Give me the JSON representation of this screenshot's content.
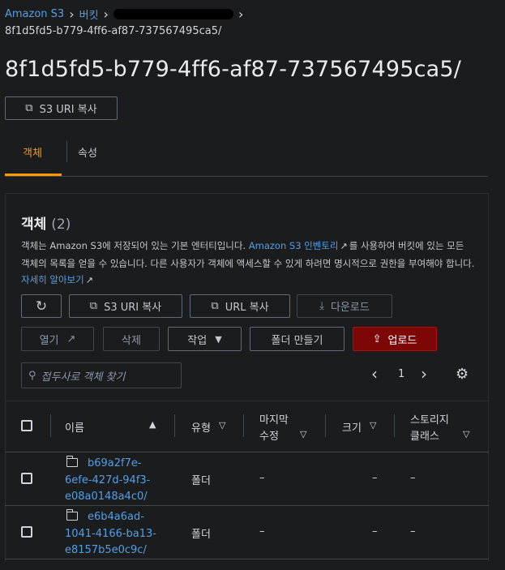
{
  "breadcrumb": {
    "items": [
      "Amazon S3",
      "버킷"
    ],
    "current": "8f1d5fd5-b779-4ff6-af87-737567495ca5/"
  },
  "page": {
    "title": "8f1d5fd5-b779-4ff6-af87-737567495ca5/",
    "copy_s3_uri": "S3 URI 복사"
  },
  "tabs": [
    {
      "label": "객체",
      "active": true
    },
    {
      "label": "속성",
      "active": false
    }
  ],
  "objects_panel": {
    "title": "객체",
    "count": "(2)",
    "description": {
      "part1": "객체는 Amazon S3에 저장되어 있는 기본 엔터티입니다.",
      "link1": "Amazon S3 인벤토리",
      "part2": "를 사용하여 버킷에 있는 모든 객체의 목록을 얻을 수 있습니다. 다른 사용자가 객체에 액세스할 수 있게 하려면 명시적으로 권한을 부여해야 합니다.",
      "link2": "자세히 알아보기"
    },
    "actions": {
      "refresh": "",
      "copy_s3_uri": "S3 URI 복사",
      "copy_url": "URL 복사",
      "download": "다운로드",
      "open": "열기",
      "delete": "삭제",
      "actions": "작업",
      "create_folder": "폴더 만들기",
      "upload": "업로드"
    },
    "search_placeholder": "접두사로 객체 찾기",
    "page_number": "1",
    "columns": [
      "이름",
      "유형",
      "마지막 수정",
      "크기",
      "스토리지 클래스"
    ],
    "columns_split": {
      "last_modified_1": "마지막",
      "last_modified_2": "수정",
      "storage_1": "스토리지",
      "storage_2": "클래스"
    },
    "rows": [
      {
        "name_lines": [
          "b69a2f7e-",
          "6efe-427d-94f3-",
          "e08a0148a4c0/"
        ],
        "type": "폴더",
        "last_modified": "–",
        "size": "–",
        "storage_class": "–"
      },
      {
        "name_lines": [
          "e6b4a6ad-",
          "1041-4166-ba13-",
          "e8157b5e0c9c/"
        ],
        "type": "폴더",
        "last_modified": "–",
        "size": "–",
        "storage_class": "–"
      }
    ]
  },
  "colors": {
    "background": "#1b1c1e",
    "link": "#539fe5",
    "active_tab": "#ff9900",
    "primary_button": "#7d0707"
  }
}
